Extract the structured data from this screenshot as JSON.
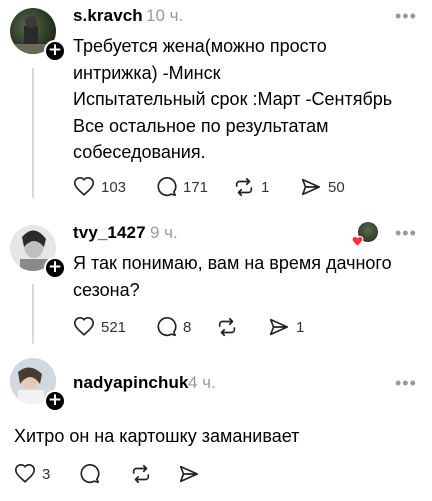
{
  "posts": [
    {
      "username": "s.kravch",
      "time": "10 ч.",
      "text": "Требуется жена(можно просто\nинтрижка) -Минск\nИспытательный срок :Март -Сентябрь\nВсе остальное по результатам\nсобеседования.",
      "likes": "103",
      "replies": "171",
      "reposts": "1",
      "shares": "50"
    },
    {
      "username": "tvy_1427",
      "time": "9 ч.",
      "text": "Я так понимаю, вам на время дачного\nсезона?",
      "likes": "521",
      "replies": "8",
      "reposts": "",
      "shares": "1"
    },
    {
      "username": "nadyapinchuk",
      "time": "4 ч.",
      "text": "Хитро он на картошку заманивает",
      "likes": "3",
      "replies": "",
      "reposts": "",
      "shares": ""
    }
  ],
  "more_label": "•••",
  "plus_label": "+"
}
